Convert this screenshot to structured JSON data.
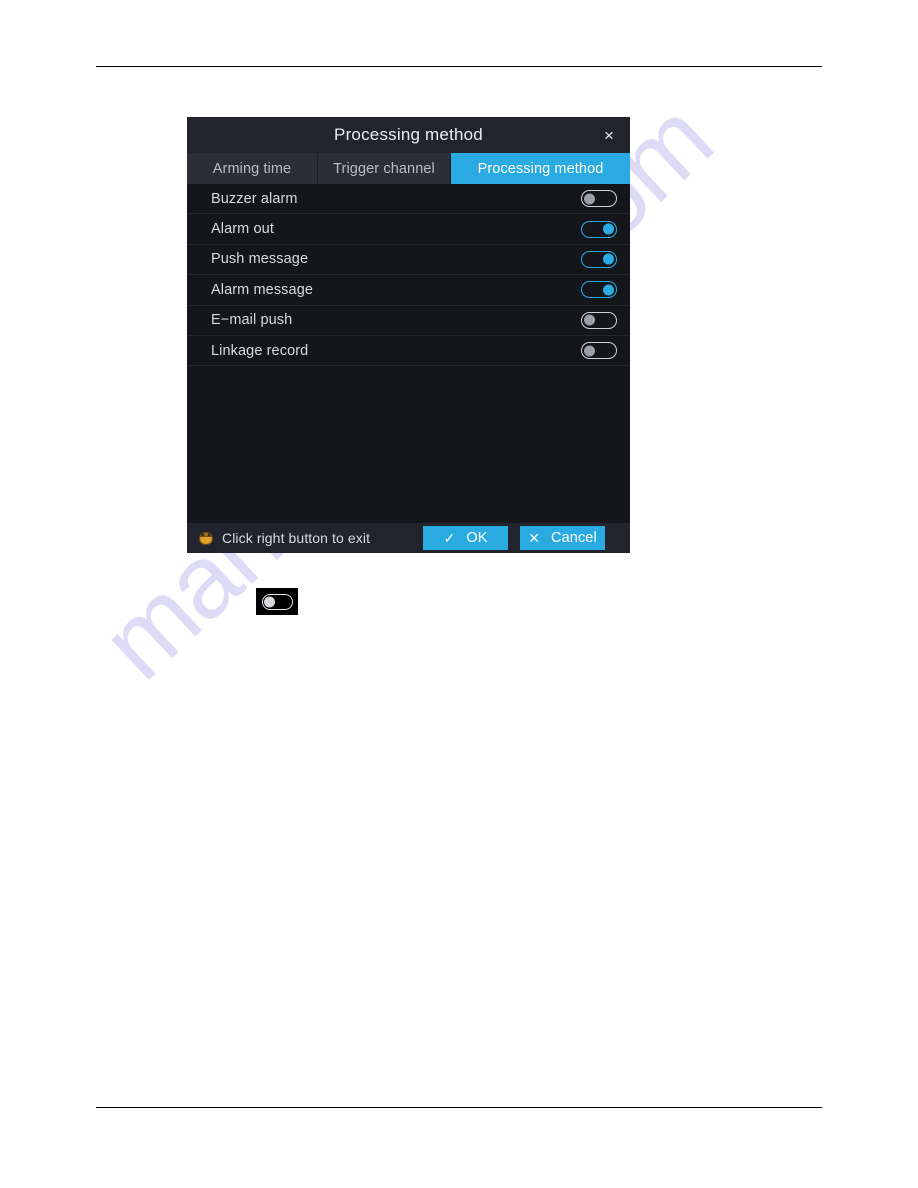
{
  "page": {
    "watermark": "manualshine.com",
    "watermark_color": "#c9c6ef"
  },
  "dialog": {
    "title": "Processing method",
    "close_icon": "×",
    "accent_color": "#29abe2",
    "background_color": "#1c1e26",
    "tabs": [
      {
        "label": "Arming time",
        "active": false
      },
      {
        "label": "Trigger channel",
        "active": false
      },
      {
        "label": "Processing method",
        "active": true
      }
    ],
    "settings": [
      {
        "label": "Buzzer alarm",
        "enabled": false
      },
      {
        "label": "Alarm out",
        "enabled": true
      },
      {
        "label": "Push message",
        "enabled": true
      },
      {
        "label": "Alarm message",
        "enabled": true
      },
      {
        "label": "E−mail push",
        "enabled": false
      },
      {
        "label": "Linkage record",
        "enabled": false
      }
    ],
    "footer": {
      "hint": "Click right button to exit",
      "hint_icon": "mouse-icon",
      "ok_label": "OK",
      "ok_glyph": "✓",
      "cancel_label": "Cancel",
      "cancel_glyph": "✕"
    }
  },
  "figure": {
    "toggle_state": "off"
  }
}
